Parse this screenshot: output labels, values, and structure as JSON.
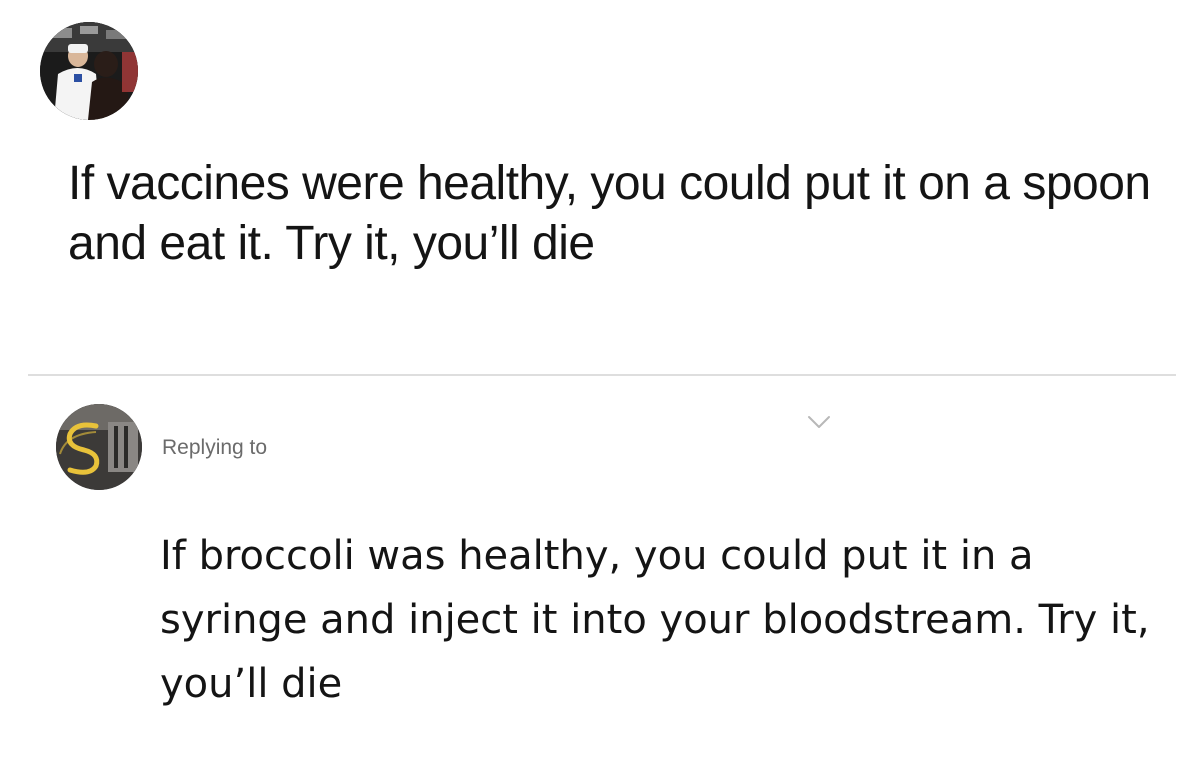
{
  "original_tweet": {
    "text": "If vaccines were healthy, you could put it on a spoon and eat it. Try it, you’ll die",
    "avatar_icon": "user-avatar-icon"
  },
  "reply_tweet": {
    "replying_to_label": "Replying to",
    "text": "If broccoli was healthy, you could put it in a syringe and inject it into your bloodstream. Try it, you’ll die",
    "avatar_icon": "user-avatar-icon",
    "menu_icon": "chevron-down-icon"
  },
  "colors": {
    "text": "#141414",
    "secondary_text": "#6b6b6b",
    "divider": "#dedede",
    "chevron": "#b8b8b8",
    "avatar_logo": "#e8c23a"
  }
}
